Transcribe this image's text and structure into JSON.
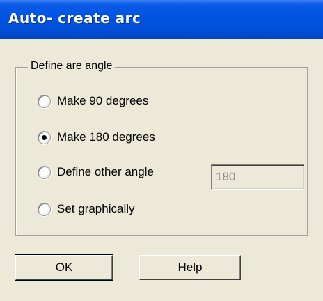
{
  "window": {
    "title": "Auto- create arc"
  },
  "group": {
    "legend": "Define are angle",
    "options": [
      {
        "label": "Make 90 degrees",
        "selected": false
      },
      {
        "label": "Make 180 degrees",
        "selected": true
      },
      {
        "label": "Define other angle",
        "selected": false
      },
      {
        "label": "Set graphically",
        "selected": false
      }
    ],
    "angle_value": "180"
  },
  "buttons": {
    "ok_label": "OK",
    "help_label": "Help"
  }
}
